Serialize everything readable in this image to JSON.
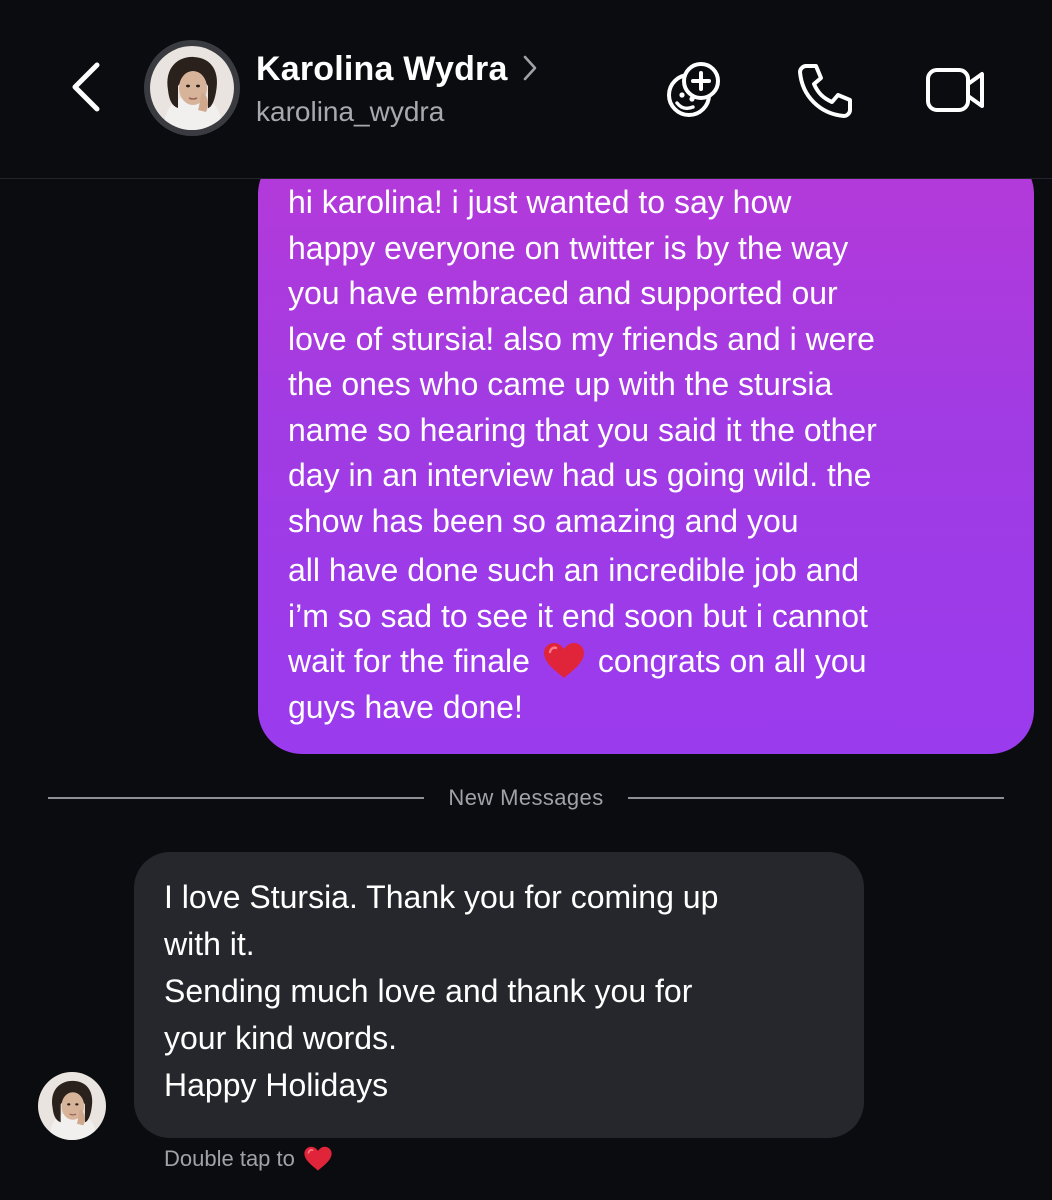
{
  "header": {
    "contact_name": "Karolina Wydra",
    "contact_handle": "karolina_wydra",
    "back_icon": "chevron-left-icon",
    "actions": [
      {
        "name": "sticker-add",
        "icon": "sticker-plus-icon"
      },
      {
        "name": "voice-call",
        "icon": "phone-icon"
      },
      {
        "name": "video-call",
        "icon": "video-camera-icon"
      }
    ]
  },
  "messages": {
    "outgoing": {
      "lines": [
        "hi karolina! i just wanted to say how",
        "happy everyone on twitter is by the way",
        "you have embraced and supported our",
        "love of stursia! also my friends and i were",
        "the ones who came up with the stursia",
        "name so hearing that you said it the other",
        "day in an interview had us going wild. the",
        "show has been so amazing and you",
        "all have done such an incredible job and",
        "i’m so sad to see it end soon but i cannot",
        "wait for the finale",
        "congrats on all you",
        "guys have done!"
      ],
      "gradient_top": "#b53ad9",
      "gradient_bottom": "#9a3bee"
    },
    "divider_label": "New Messages",
    "incoming": {
      "lines": [
        "I love Stursia. Thank you for coming up",
        "with it.",
        "Sending much love and thank you for",
        "your kind words.",
        "Happy Holidays"
      ],
      "bubble_color": "#26272c"
    },
    "reaction_hint": "Double tap to",
    "heart_color": "#e0243a"
  }
}
